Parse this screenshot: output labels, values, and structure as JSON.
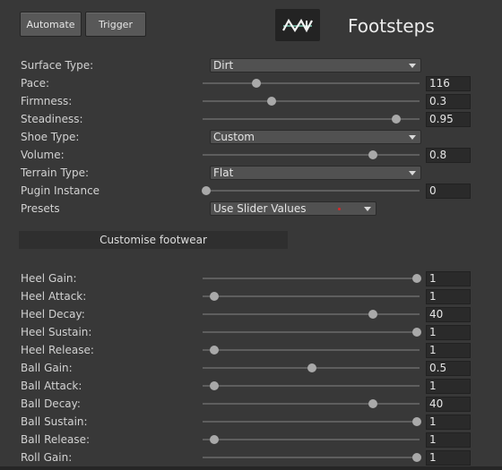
{
  "toolbar": {
    "automate_label": "Automate",
    "trigger_label": "Trigger"
  },
  "header": {
    "title": "Footsteps",
    "logo_icon": "footsteps-logo-icon"
  },
  "colors": {
    "background": "#383838",
    "accent_teal": "#7ecfb7",
    "indicator_red": "#d82828"
  },
  "rows": [
    {
      "name": "surface-type",
      "label": "Surface Type:",
      "control": "dropdown",
      "value": "Dirt"
    },
    {
      "name": "pace",
      "label": "Pace:",
      "control": "slider",
      "value": "116",
      "level": 0.24
    },
    {
      "name": "firmness",
      "label": "Firmness:",
      "control": "slider",
      "value": "0.3",
      "level": 0.31
    },
    {
      "name": "steadiness",
      "label": "Steadiness:",
      "control": "slider",
      "value": "0.95",
      "level": 0.9
    },
    {
      "name": "shoe-type",
      "label": "Shoe Type:",
      "control": "dropdown",
      "value": "Custom"
    },
    {
      "name": "volume",
      "label": "Volume:",
      "control": "slider",
      "value": "0.8",
      "level": 0.79
    },
    {
      "name": "terrain-type",
      "label": "Terrain Type:",
      "control": "dropdown",
      "value": "Flat"
    },
    {
      "name": "pugin-instance",
      "label": "Pugin Instance",
      "control": "slider",
      "value": "0",
      "level": 0.0
    },
    {
      "name": "presets",
      "label": "Presets",
      "control": "dropdown-short",
      "value": "Use Slider Values"
    }
  ],
  "section": {
    "label": "Customise footwear"
  },
  "footwear": [
    {
      "name": "heel-gain",
      "label": "Heel Gain:",
      "value": "1",
      "level": 1.0
    },
    {
      "name": "heel-attack",
      "label": "Heel Attack:",
      "value": "1",
      "level": 0.04
    },
    {
      "name": "heel-decay",
      "label": "Heel Decay:",
      "value": "40",
      "level": 0.79
    },
    {
      "name": "heel-sustain",
      "label": "Heel Sustain:",
      "value": "1",
      "level": 1.0
    },
    {
      "name": "heel-release",
      "label": "Heel Release:",
      "value": "1",
      "level": 0.04
    },
    {
      "name": "ball-gain",
      "label": "Ball Gain:",
      "value": "0.5",
      "level": 0.5
    },
    {
      "name": "ball-attack",
      "label": "Ball Attack:",
      "value": "1",
      "level": 0.04
    },
    {
      "name": "ball-decay",
      "label": "Ball Decay:",
      "value": "40",
      "level": 0.79
    },
    {
      "name": "ball-sustain",
      "label": "Ball Sustain:",
      "value": "1",
      "level": 1.0
    },
    {
      "name": "ball-release",
      "label": "Ball Release:",
      "value": "1",
      "level": 0.04
    },
    {
      "name": "roll-gain",
      "label": "Roll Gain:",
      "value": "1",
      "level": 1.0
    }
  ]
}
